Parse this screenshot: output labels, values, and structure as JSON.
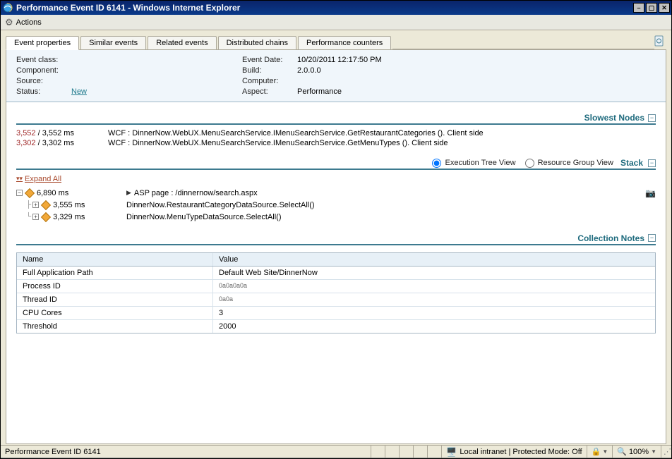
{
  "window": {
    "title": "Performance Event ID 6141 - Windows Internet Explorer"
  },
  "toolbar": {
    "actions": "Actions"
  },
  "tabs": [
    {
      "label": "Event properties",
      "active": true
    },
    {
      "label": "Similar events"
    },
    {
      "label": "Related events"
    },
    {
      "label": "Distributed chains"
    },
    {
      "label": "Performance counters"
    }
  ],
  "summary": {
    "event_class_label": "Event class:",
    "component_label": "Component:",
    "source_label": "Source:",
    "status_label": "Status:",
    "status_value": "New",
    "event_date_label": "Event Date:",
    "event_date_value": "10/20/2011 12:17:50 PM",
    "build_label": "Build:",
    "build_value": "2.0.0.0",
    "computer_label": "Computer:",
    "aspect_label": "Aspect:",
    "aspect_value": "Performance"
  },
  "sections": {
    "slowest_nodes": "Slowest Nodes",
    "stack": "Stack",
    "collection_notes": "Collection Notes"
  },
  "slowest": [
    {
      "t1": "3,552",
      "sep": " / ",
      "t2": "3,552 ms",
      "desc": "WCF : DinnerNow.WebUX.MenuSearchService.IMenuSearchService.GetRestaurantCategories (). Client side"
    },
    {
      "t1": "3,302",
      "sep": " / ",
      "t2": "3,302 ms",
      "desc": "WCF : DinnerNow.WebUX.MenuSearchService.IMenuSearchService.GetMenuTypes (). Client side"
    }
  ],
  "stack": {
    "expand_all": "Expand All",
    "exec_view": "Execution Tree View",
    "res_view": "Resource Group View",
    "rows": [
      {
        "depth": 0,
        "expander": "−",
        "time": "6,890 ms",
        "desc": "ASP page : /dinnernow/search.aspx",
        "has_tri": true,
        "camera": true
      },
      {
        "depth": 1,
        "expander": "+",
        "time": "3,555 ms",
        "desc": "DinnerNow.RestaurantCategoryDataSource.SelectAll()"
      },
      {
        "depth": 1,
        "expander": "+",
        "time": "3,329 ms",
        "desc": "DinnerNow.MenuTypeDataSource.SelectAll()"
      }
    ]
  },
  "grid": {
    "header_name": "Name",
    "header_value": "Value",
    "rows": [
      {
        "name": "Full Application Path",
        "value": "Default Web Site/DinnerNow"
      },
      {
        "name": "Process ID",
        "value": "0a0a0a0a",
        "small": true
      },
      {
        "name": "Thread ID",
        "value": "0a0a",
        "small": true
      },
      {
        "name": "CPU Cores",
        "value": "3"
      },
      {
        "name": "Threshold",
        "value": "2000"
      }
    ]
  },
  "status": {
    "page": "Performance Event ID 6141",
    "zone": "Local intranet | Protected Mode: Off",
    "zoom": "100%"
  }
}
